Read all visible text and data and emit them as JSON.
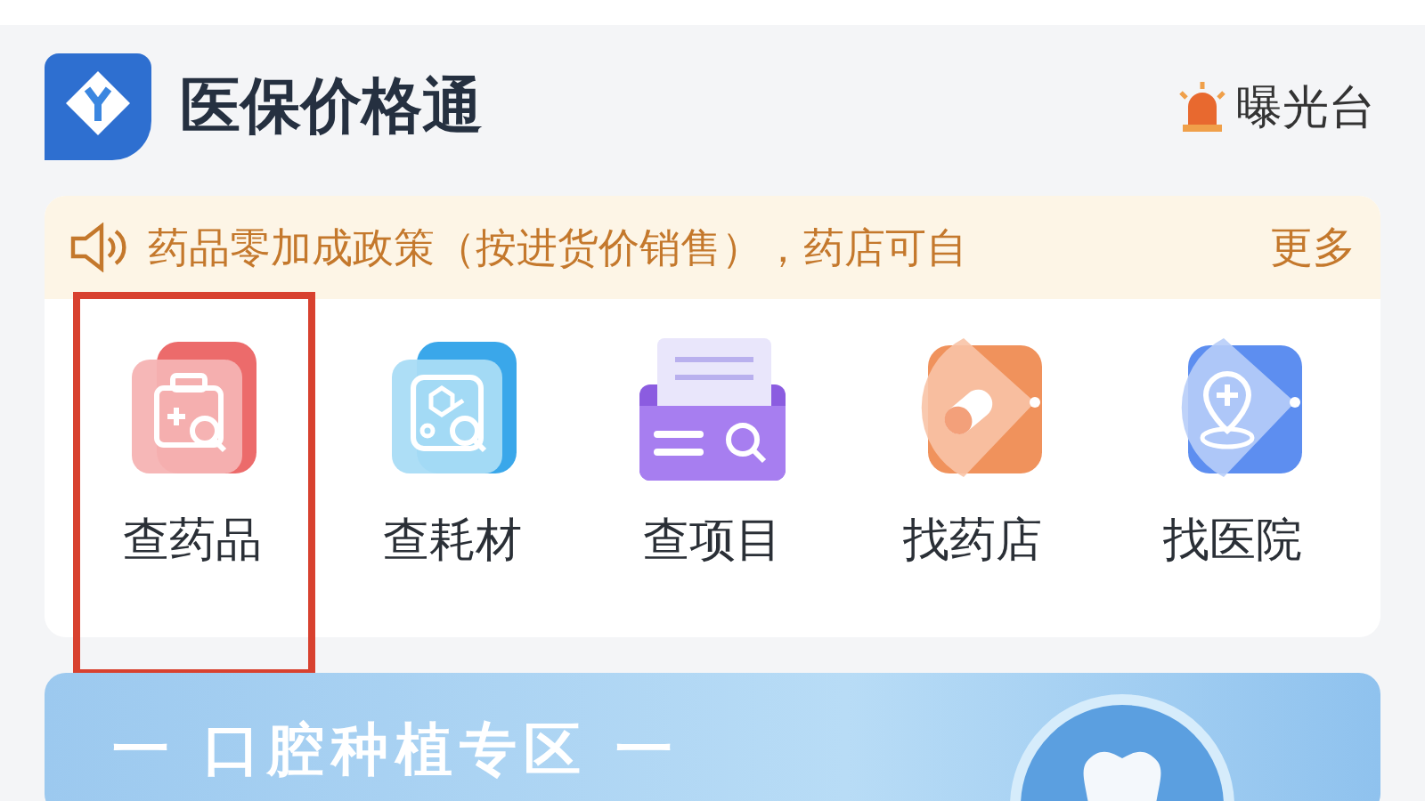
{
  "header": {
    "title": "医保价格通",
    "exposure_label": "曝光台"
  },
  "notice": {
    "text": "药品零加成政策（按进货价销售），药店可自",
    "more": "更多"
  },
  "services": [
    {
      "kind": "medicine",
      "label": "查药品",
      "highlighted": true
    },
    {
      "kind": "supplies",
      "label": "查耗材",
      "highlighted": false
    },
    {
      "kind": "project",
      "label": "查项目",
      "highlighted": false
    },
    {
      "kind": "pharmacy",
      "label": "找药店",
      "highlighted": false
    },
    {
      "kind": "hospital",
      "label": "找医院",
      "highlighted": false
    }
  ],
  "banner": {
    "title": "一 口腔种植专区 一"
  }
}
